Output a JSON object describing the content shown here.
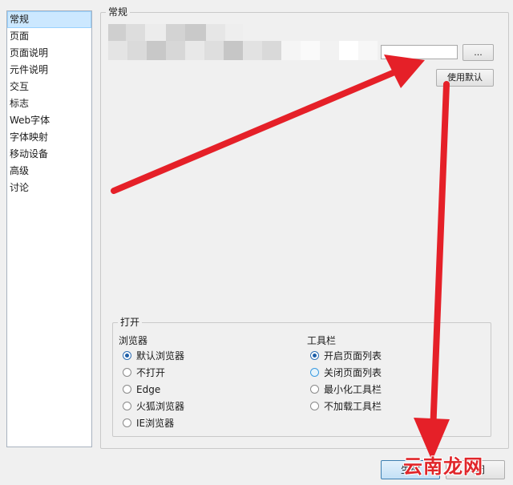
{
  "sidebar": {
    "items": [
      {
        "label": "常规",
        "selected": true
      },
      {
        "label": "页面"
      },
      {
        "label": "页面说明"
      },
      {
        "label": "元件说明"
      },
      {
        "label": "交互"
      },
      {
        "label": "标志"
      },
      {
        "label": "Web字体"
      },
      {
        "label": "字体映射"
      },
      {
        "label": "移动设备"
      },
      {
        "label": "高级"
      },
      {
        "label": "讨论"
      }
    ]
  },
  "general": {
    "title": "常规",
    "browse_label": "...",
    "use_default_label": "使用默认"
  },
  "open": {
    "title": "打开",
    "browser": {
      "heading": "浏览器",
      "options": [
        "默认浏览器",
        "不打开",
        "Edge",
        "火狐浏览器",
        "IE浏览器"
      ],
      "selected": "默认浏览器"
    },
    "toolbar": {
      "heading": "工具栏",
      "options": [
        "开启页面列表",
        "关闭页面列表",
        "最小化工具栏",
        "不加载工具栏"
      ],
      "selected": "开启页面列表"
    }
  },
  "footer": {
    "generate_label": "生成",
    "close_label": "关闭"
  },
  "watermark": "云南龙网",
  "colors": {
    "selection": "#cce8ff",
    "arrow": "#e52028",
    "radio_selected": "#1f5fa8"
  }
}
